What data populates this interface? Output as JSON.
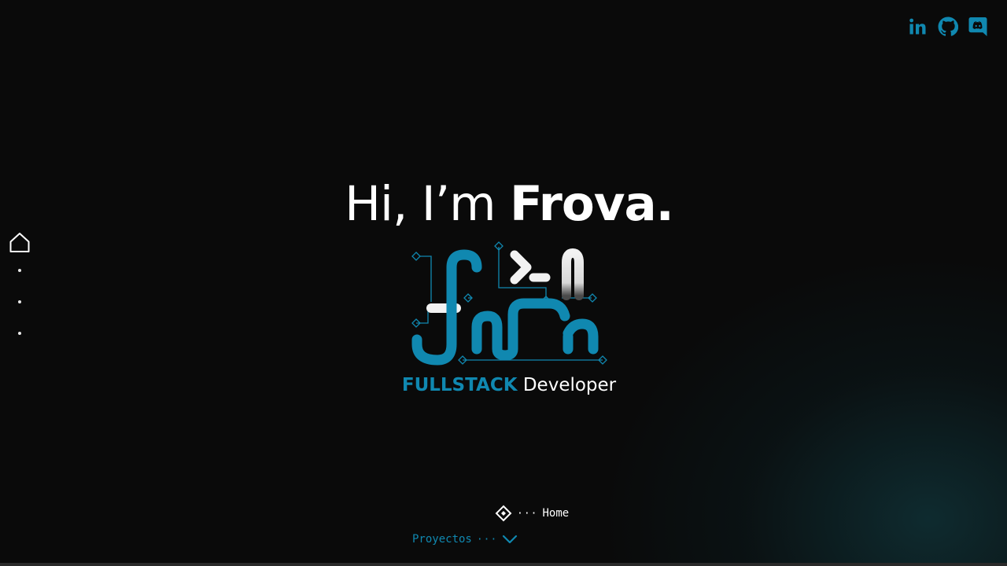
{
  "colors": {
    "background": "#0a0a0a",
    "accent": "#1088b0",
    "text": "#ffffff"
  },
  "socials": [
    {
      "icon": "linkedin-icon"
    },
    {
      "icon": "github-icon"
    },
    {
      "icon": "discord-icon"
    }
  ],
  "side_nav": {
    "home_icon": "home-icon",
    "dots": 3
  },
  "hero": {
    "greeting": "Hi, I’m ",
    "name": "Frova."
  },
  "tagline": {
    "accent": "FULLSTACK",
    "rest": " Developer"
  },
  "section_indicator": {
    "current_icon": "diamond-icon",
    "dashes": "···",
    "current": "Home",
    "next": "Proyectos",
    "next_dashes": "···",
    "next_icon": "chevron-down-icon"
  }
}
